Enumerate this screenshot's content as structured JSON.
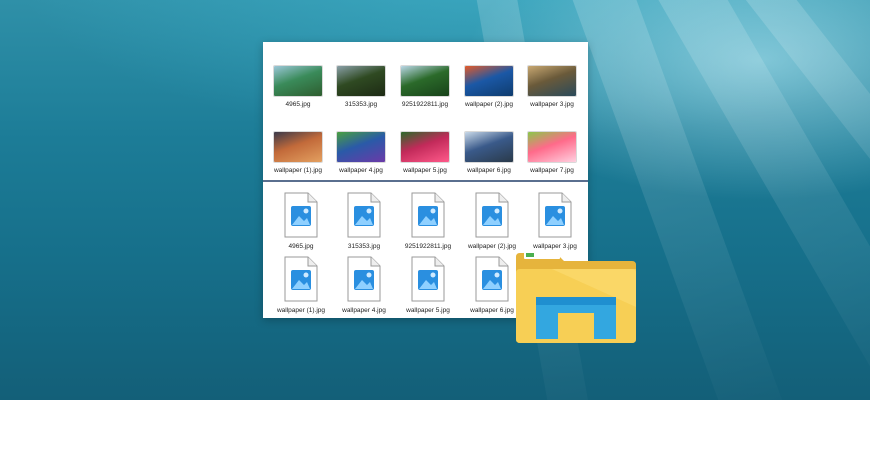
{
  "thumb_view": {
    "row1": [
      {
        "name": "4965.jpg",
        "colors": [
          "#3a8b5a",
          "#9bc7d8",
          "#2e5d2f"
        ]
      },
      {
        "name": "315353.jpg",
        "colors": [
          "#2f4a22",
          "#8aa0a8",
          "#1d2a14"
        ]
      },
      {
        "name": "9251922811.jpg",
        "colors": [
          "#2b6a2a",
          "#b9d6e6",
          "#18421a"
        ]
      },
      {
        "name": "wallpaper  (2).jpg",
        "colors": [
          "#1b58a6",
          "#e35a2a",
          "#0f3c6e"
        ]
      },
      {
        "name": "wallpaper  3.jpg",
        "colors": [
          "#6a5a3a",
          "#c8a872",
          "#2a4a5a"
        ]
      }
    ],
    "row2": [
      {
        "name": "wallpaper (1).jpg",
        "colors": [
          "#c26a3a",
          "#3a3a4a",
          "#e3a060"
        ]
      },
      {
        "name": "wallpaper 4.jpg",
        "colors": [
          "#2a5aa8",
          "#4aa040",
          "#6b3aa8"
        ]
      },
      {
        "name": "wallpaper 5.jpg",
        "colors": [
          "#c22a5a",
          "#2a6a2a",
          "#ff5a8a"
        ]
      },
      {
        "name": "wallpaper 6.jpg",
        "colors": [
          "#3a5a8a",
          "#c8d8e8",
          "#2a3a4a"
        ]
      },
      {
        "name": "wallpaper 7.jpg",
        "colors": [
          "#ff6a8a",
          "#8ac84a",
          "#ffd0e0"
        ]
      }
    ]
  },
  "icon_view": {
    "row1": [
      "4965.jpg",
      "315353.jpg",
      "9251922811.jpg",
      "wallpaper  (2).jpg",
      "wallpaper  3.jpg"
    ],
    "row2": [
      "wallpaper (1).jpg",
      "wallpaper 4.jpg",
      "wallpaper 5.jpg",
      "wallpaper 6.jpg"
    ]
  },
  "icons": {
    "image_file": "image-file-icon",
    "explorer": "file-explorer-folder-icon"
  },
  "colors": {
    "file_blue": "#2a8fe0",
    "folder_yellow": "#f7cf55",
    "folder_blue": "#33a7e0"
  }
}
